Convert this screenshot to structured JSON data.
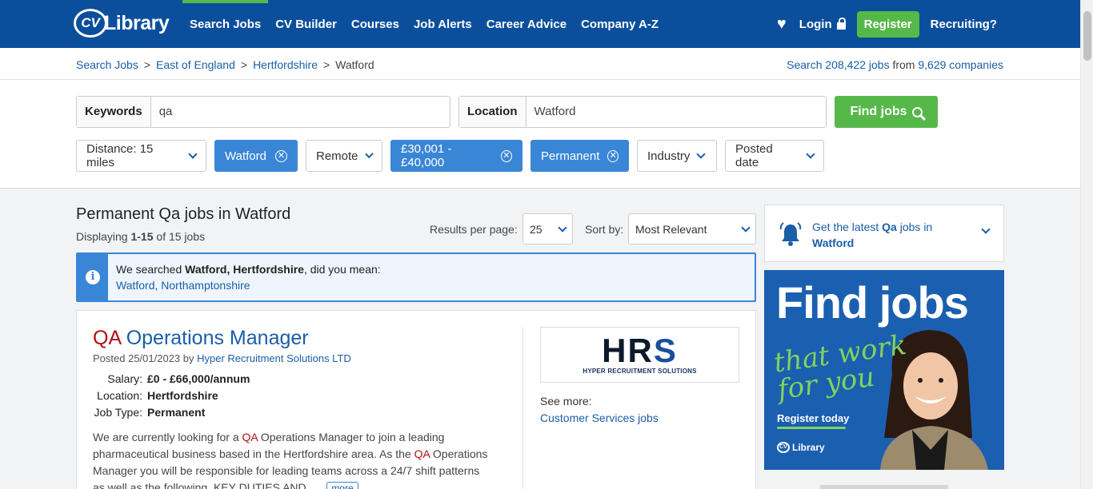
{
  "header": {
    "logo_cv": "CV",
    "logo_text": "Library",
    "nav": [
      "Search Jobs",
      "CV Builder",
      "Courses",
      "Job Alerts",
      "Career Advice",
      "Company A-Z"
    ],
    "login": "Login",
    "register": "Register",
    "recruiting": "Recruiting?"
  },
  "breadcrumb": {
    "items": [
      "Search Jobs",
      "East of England",
      "Hertfordshire"
    ],
    "current": "Watford",
    "separator": ">"
  },
  "stats": {
    "prefix": "Search ",
    "jobs": "208,422 jobs",
    "middle": " from ",
    "companies": "9,629 companies"
  },
  "search": {
    "keywords_label": "Keywords",
    "keywords_value": "qa",
    "location_label": "Location",
    "location_value": "Watford",
    "find_button": "Find jobs"
  },
  "filters": {
    "distance": "Distance: 15 miles",
    "watford": "Watford",
    "remote": "Remote",
    "salary": "£30,001 - £40,000",
    "permanent": "Permanent",
    "industry": "Industry",
    "posted_date": "Posted date"
  },
  "results": {
    "title": "Permanent Qa jobs in Watford",
    "displaying_prefix": "Displaying ",
    "displaying_range": "1-15",
    "displaying_suffix": " of 15 jobs",
    "per_page_label": "Results per page:",
    "per_page_value": "25",
    "sort_label": "Sort by:",
    "sort_value": "Most Relevant"
  },
  "notice": {
    "prefix": "We searched ",
    "searched": "Watford, Hertfordshire",
    "suffix": ", did you mean:",
    "suggestion": "Watford, Northamptonshire"
  },
  "job": {
    "title_highlight": "QA",
    "title_rest": " Operations Manager",
    "posted_prefix": "Posted 25/01/2023 by ",
    "company": "Hyper Recruitment Solutions LTD",
    "salary_label": "Salary:",
    "salary": "£0 - £66,000/annum",
    "location_label": "Location:",
    "location": "Hertfordshire",
    "type_label": "Job Type:",
    "type": "Permanent",
    "desc_1": "We are currently looking for a ",
    "desc_hl1": "QA",
    "desc_2": " Operations Manager to join a leading pharmaceutical business based in the Hertfordshire area. As the ",
    "desc_hl2": "QA",
    "desc_3": " Operations Manager you will be responsible for leading teams across a 24/7 shift patterns as well as the following. KEY DUTIES AND...",
    "more": "more",
    "logo_main": "HR",
    "logo_s": "S",
    "logo_sub": "HYPER RECRUITMENT SOLUTIONS",
    "see_more_label": "See more:",
    "see_more_link": "Customer Services jobs"
  },
  "alert": {
    "prefix": "Get the latest ",
    "keyword": "Qa",
    "middle": " jobs in",
    "location": "Watford"
  },
  "ad": {
    "headline": "Find jobs",
    "script_1": "that work",
    "script_2": "for you",
    "cta": "Register today",
    "logo_cv": "CV",
    "logo_text": "Library"
  },
  "colors": {
    "header_blue": "#0b4f9c",
    "accent_green": "#57b84a",
    "link_blue": "#1a5ea6",
    "chip_blue": "#3a86d6",
    "highlight_red": "#b11111"
  }
}
